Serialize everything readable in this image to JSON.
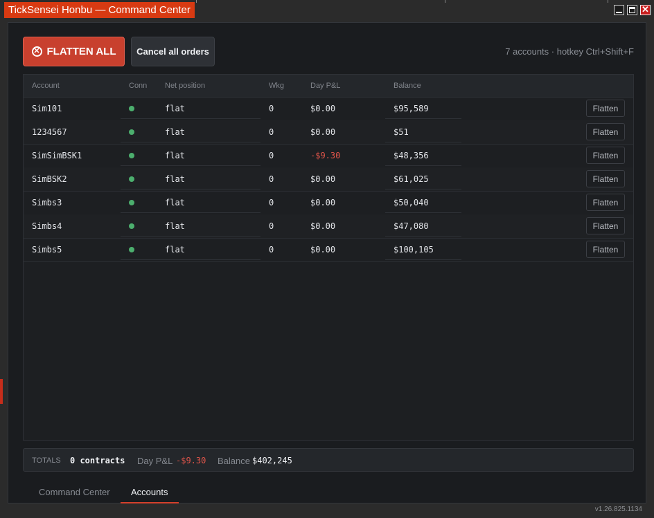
{
  "window": {
    "title": "TickSensei Honbu — Command Center"
  },
  "header": {
    "flatten_all_label": "FLATTEN ALL",
    "cancel_all_label": "Cancel all orders",
    "info_text": "7 accounts · hotkey Ctrl+Shift+F"
  },
  "table": {
    "columns": {
      "account": "Account",
      "conn": "Conn",
      "net_position": "Net position",
      "wkg": "Wkg",
      "day_pnl": "Day P&L",
      "balance": "Balance"
    },
    "row_action_label": "Flatten",
    "rows": [
      {
        "account": "Sim101",
        "conn": "connected",
        "net_position": "flat",
        "wkg": "0",
        "day_pnl": "$0.00",
        "balance": "$95,589",
        "action": "Flatten"
      },
      {
        "account": "1234567",
        "conn": "connected",
        "net_position": "flat",
        "wkg": "0",
        "day_pnl": "$0.00",
        "balance": "$51",
        "action": "Flatten"
      },
      {
        "account": "SimSimBSK1",
        "conn": "connected",
        "net_position": "flat",
        "wkg": "0",
        "day_pnl": "-$9.30",
        "balance": "$48,356",
        "action": "Flatten"
      },
      {
        "account": "SimBSK2",
        "conn": "connected",
        "net_position": "flat",
        "wkg": "0",
        "day_pnl": "$0.00",
        "balance": "$61,025",
        "action": "Flatten"
      },
      {
        "account": "Simbs3",
        "conn": "connected",
        "net_position": "flat",
        "wkg": "0",
        "day_pnl": "$0.00",
        "balance": "$50,040",
        "action": "Flatten"
      },
      {
        "account": "Simbs4",
        "conn": "connected",
        "net_position": "flat",
        "wkg": "0",
        "day_pnl": "$0.00",
        "balance": "$47,080",
        "action": "Flatten"
      },
      {
        "account": "Simbs5",
        "conn": "connected",
        "net_position": "flat",
        "wkg": "0",
        "day_pnl": "$0.00",
        "balance": "$100,105",
        "action": "Flatten"
      }
    ]
  },
  "totals": {
    "label": "TOTALS",
    "contracts": "0 contracts",
    "day_pnl_label": "Day P&L",
    "day_pnl": "-$9.30",
    "balance_label": "Balance",
    "balance": "$402,245"
  },
  "tabs": [
    {
      "label": "Command Center",
      "active": false
    },
    {
      "label": "Accounts",
      "active": true
    }
  ],
  "version": "v1.26.825.1134",
  "colors": {
    "accent": "#d83a12",
    "flatten_button": "#c8402e",
    "connected": "#4caf6e",
    "negative": "#e0554a",
    "background": "#1a1c1f"
  },
  "icons": {
    "flatten_all": "x-circle-icon",
    "connection": "status-dot-icon"
  }
}
